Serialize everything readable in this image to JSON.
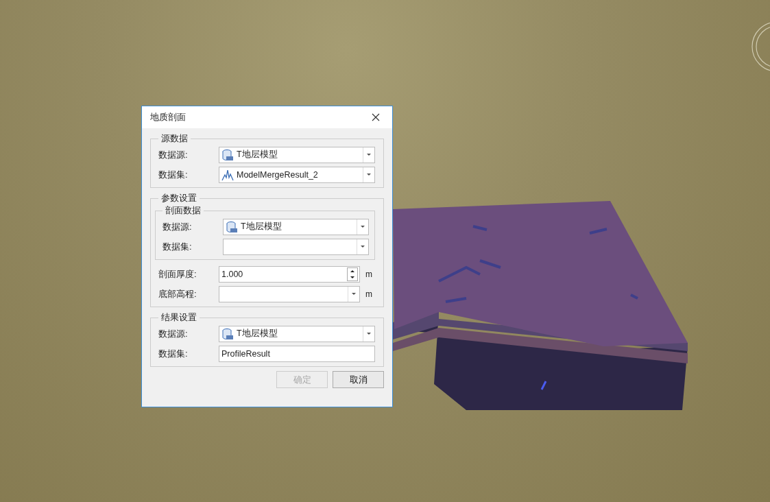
{
  "dialog": {
    "title": "地质剖面",
    "groups": [
      {
        "title": "源数据",
        "items": [
          {
            "kind": "datasource",
            "label": "数据源:",
            "value": "T地层模型"
          },
          {
            "kind": "dataset",
            "label": "数据集:",
            "value": "ModelMergeResult_2"
          }
        ]
      },
      {
        "title": "参数设置",
        "items": [
          {
            "kind": "group",
            "title": "剖面数据",
            "children": [
              {
                "kind": "datasource",
                "label": "数据源:",
                "value": "T地层模型"
              },
              {
                "kind": "combo",
                "label": "数据集:"
              }
            ]
          },
          {
            "kind": "spin",
            "label": "剖面厚度:",
            "value": "1.000",
            "unit": "m"
          },
          {
            "kind": "combo",
            "label": "底部高程:",
            "unit": "m"
          }
        ]
      },
      {
        "title": "结果设置",
        "items": [
          {
            "kind": "datasource",
            "label": "数据源:",
            "value": "T地层模型"
          },
          {
            "kind": "text",
            "label": "数据集:",
            "value": "ProfileResult"
          }
        ]
      }
    ],
    "buttons": [
      {
        "label": "确定",
        "disabled": true
      },
      {
        "label": "取消",
        "disabled": false
      }
    ]
  }
}
